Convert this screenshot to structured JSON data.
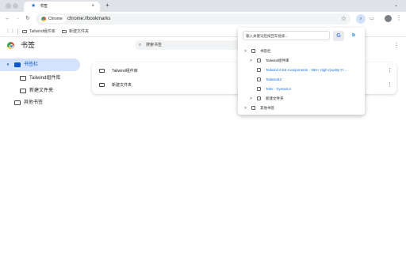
{
  "browser": {
    "tab": {
      "title": "书签",
      "close": "×"
    },
    "new_tab": "+",
    "nav": {
      "back": "←",
      "forward": "→",
      "reload": "↻"
    },
    "omnibox": {
      "chip_label": "Chrome",
      "url": "chrome://bookmarks"
    },
    "star": "☆",
    "menu": "⋮"
  },
  "bookmarks_bar": {
    "apps": "⋮⋮",
    "items": [
      {
        "label": "Tailwind组件库"
      },
      {
        "label": "新建文件夹"
      }
    ]
  },
  "page": {
    "title": "书签",
    "search_placeholder": "搜索书签",
    "menu": "⋮",
    "tree": [
      {
        "label": "书签栏",
        "selected": true,
        "expanded": true
      },
      {
        "label": "Tailwind组件库"
      },
      {
        "label": "新建文件夹"
      },
      {
        "label": "其他书签"
      }
    ],
    "list": [
      {
        "label": "Tailwind组件库",
        "more": "⋮"
      },
      {
        "label": "新建文件夹",
        "more": "⋮"
      }
    ]
  },
  "popup": {
    "search_placeholder": "输入关键词后按回车搜索...",
    "engines": {
      "google": "G",
      "bing": "b"
    },
    "tree": [
      {
        "label": "书签栏",
        "arrow": ">",
        "link": false
      },
      {
        "label": "Tailwind组件库",
        "arrow": ">",
        "link": false
      },
      {
        "label": "Tailwind CSS Components - 350+ High Quality Fr...",
        "arrow": "",
        "link": true
      },
      {
        "label": "TailwindUI",
        "arrow": "",
        "link": true
      },
      {
        "label": "Tebs - SyntaxUI",
        "arrow": "",
        "link": true
      },
      {
        "label": "新建文件夹",
        "arrow": ">",
        "link": false
      },
      {
        "label": "其他书签",
        "arrow": ">",
        "link": false
      }
    ]
  },
  "colors": {
    "accent": "#1a73e8",
    "selected_bg": "#d3e3fd",
    "tabstrip": "#dfe3e7",
    "omnibox": "#f1f3f4"
  }
}
